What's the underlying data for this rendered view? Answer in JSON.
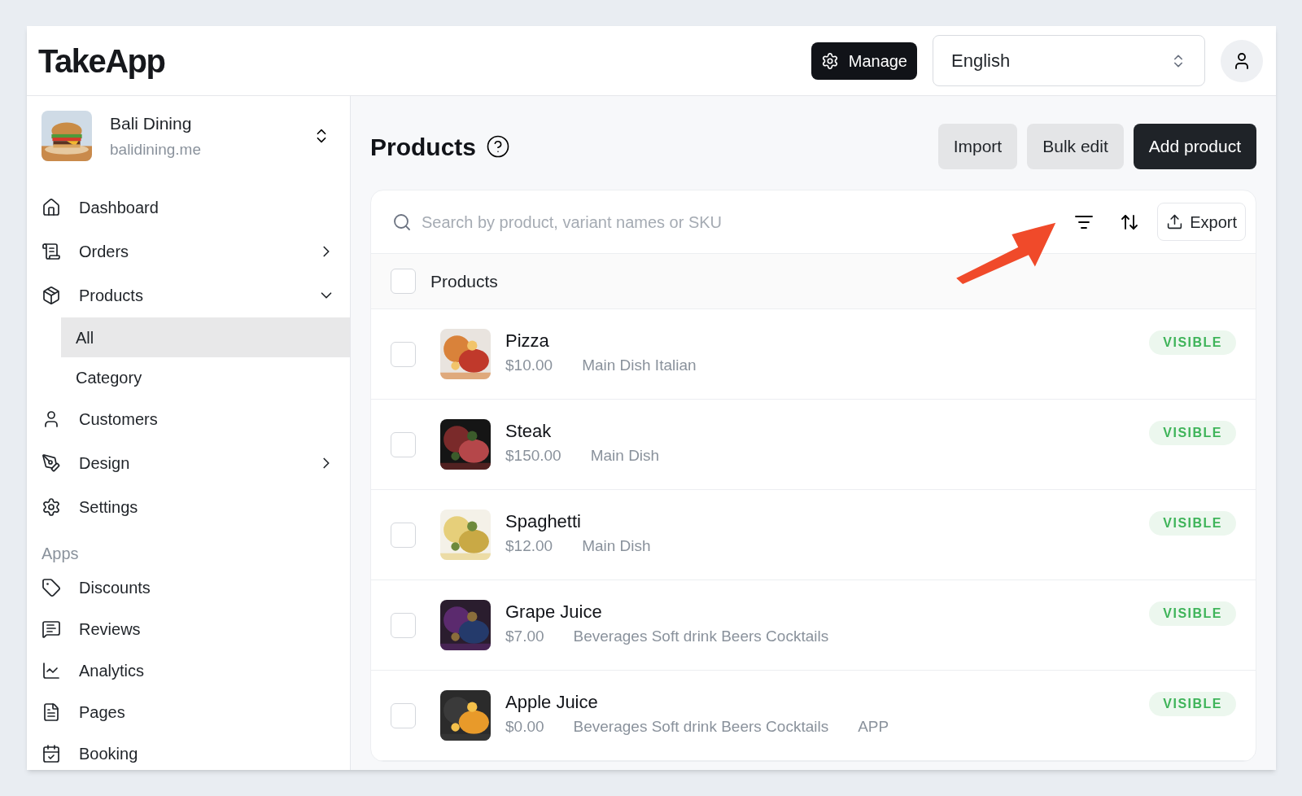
{
  "logo": "TakeApp",
  "header": {
    "manage_button": "Manage",
    "language": "English"
  },
  "store": {
    "name": "Bali Dining",
    "domain": "balidining.me"
  },
  "nav": [
    {
      "label": "Dashboard"
    },
    {
      "label": "Orders",
      "expanded": false
    },
    {
      "label": "Products",
      "expanded": true,
      "children": [
        {
          "label": "All",
          "selected": true
        },
        {
          "label": "Category",
          "selected": false
        }
      ]
    },
    {
      "label": "Customers"
    },
    {
      "label": "Design",
      "expanded": false
    },
    {
      "label": "Settings"
    }
  ],
  "apps": {
    "heading": "Apps",
    "items": [
      {
        "label": "Discounts"
      },
      {
        "label": "Reviews"
      },
      {
        "label": "Analytics"
      },
      {
        "label": "Pages"
      },
      {
        "label": "Booking"
      }
    ]
  },
  "page": {
    "title": "Products",
    "buttons": [
      "Import",
      "Bulk edit",
      "Add product"
    ]
  },
  "toolbar": {
    "search_placeholder": "Search by product, variant names or SKU",
    "export": "Export"
  },
  "table": {
    "header": {
      "label": "Products",
      "checked": false
    },
    "rows": [
      {
        "name": "Pizza",
        "price": "$10.00",
        "categories": "Main Dish Italian",
        "status": "VISIBLE",
        "checked": false
      },
      {
        "name": "Steak",
        "price": "$150.00",
        "categories": "Main Dish",
        "status": "VISIBLE",
        "checked": false
      },
      {
        "name": "Spaghetti",
        "price": "$12.00",
        "categories": "Main Dish",
        "status": "VISIBLE",
        "checked": false
      },
      {
        "name": "Grape Juice",
        "price": "$7.00",
        "categories": "Beverages Soft drink Beers Cocktails",
        "status": "VISIBLE",
        "checked": false
      },
      {
        "name": "Apple Juice",
        "price": "$0.00",
        "categories": "Beverages Soft drink Beers Cocktails",
        "extra": "APP",
        "status": "VISIBLE",
        "checked": false
      }
    ]
  }
}
